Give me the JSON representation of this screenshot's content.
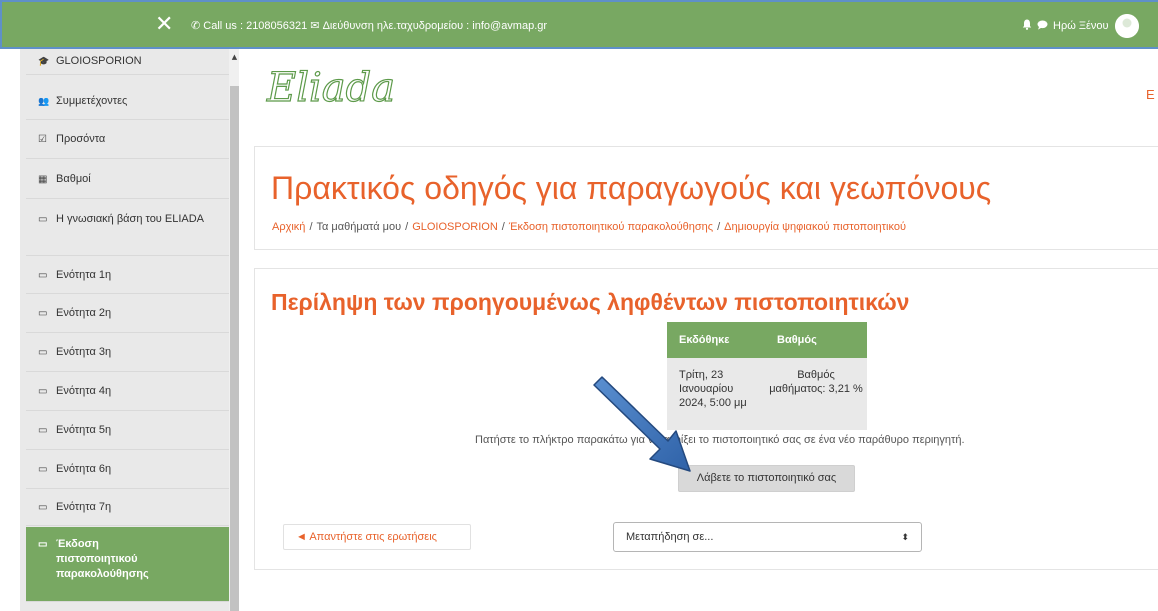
{
  "topbar": {
    "close_glyph": "✕",
    "contact_text": "Call us : 2108056321 ✉ Διεύθυνση ηλε.ταχυδρομείου : info@avmap.gr",
    "phone_icon": "phone-icon",
    "user_name": "Ηρώ Ξένου",
    "icons": [
      "bell-icon",
      "chat-icon",
      "avatar-icon"
    ]
  },
  "sidebar": {
    "items": [
      {
        "icon": "graduation-cap-icon",
        "glyph": "🎓",
        "label": "GLOIOSPORION"
      },
      {
        "icon": "users-icon",
        "glyph": "👥",
        "label": "Συμμετέχοντες"
      },
      {
        "icon": "checkbox-icon",
        "glyph": "☑",
        "label": "Προσόντα"
      },
      {
        "icon": "table-icon",
        "glyph": "▦",
        "label": "Βαθμοί"
      },
      {
        "icon": "folder-icon",
        "glyph": "▭",
        "label": "Η γνωσιακή βάση του ELIADA"
      },
      {
        "icon": "folder-icon",
        "glyph": "▭",
        "label": "Ενότητα 1η"
      },
      {
        "icon": "folder-icon",
        "glyph": "▭",
        "label": "Ενότητα 2η"
      },
      {
        "icon": "folder-icon",
        "glyph": "▭",
        "label": "Ενότητα 3η"
      },
      {
        "icon": "folder-icon",
        "glyph": "▭",
        "label": "Ενότητα 4η"
      },
      {
        "icon": "folder-icon",
        "glyph": "▭",
        "label": "Ενότητα 5η"
      },
      {
        "icon": "folder-icon",
        "glyph": "▭",
        "label": "Ενότητα 6η"
      },
      {
        "icon": "folder-icon",
        "glyph": "▭",
        "label": "Ενότητα 7η"
      },
      {
        "icon": "folder-icon",
        "glyph": "▭",
        "label": "Έκδοση πιστοποιητικού παρακολούθησης"
      }
    ]
  },
  "header": {
    "logo_text": "Eliada",
    "top_right_letter": "E"
  },
  "page": {
    "title": "Πρακτικός οδηγός για παραγωγούς και γεωπόνους",
    "breadcrumb": {
      "home": "Αρχική",
      "my_courses": "Τα μαθήματά μου",
      "course": "GLOIOSPORION",
      "section": "Έκδοση πιστοποιητικού παρακολούθησης",
      "activity": "Δημιουργία ψηφιακού πιστοποιητικού",
      "separator": "/"
    }
  },
  "certificates": {
    "heading": "Περίληψη των προηγουμένως ληφθέντων πιστοποιητικών",
    "columns": [
      "Εκδόθηκε",
      "Βαθμός"
    ],
    "rows": [
      {
        "issued": "Τρίτη, 23 Ιανουαρίου 2024, 5:00 μμ",
        "grade": "Βαθμός μαθήματος: 3,21 %"
      }
    ],
    "instruction": "Πατήστε το πλήκτρο παρακάτω για να ανοίξει το πιστοποιητικό σας σε ένα νέο παράθυρο περιηγητή.",
    "button_label": "Λάβετε το πιστοποιητικό σας"
  },
  "navigation": {
    "prev_label": "◄ Απαντήστε στις ερωτήσεις",
    "jump_placeholder": "Μεταπήδηση σε...",
    "jump_caret": "⬍"
  },
  "colors": {
    "accent_green": "#78a862",
    "accent_orange": "#e8622b",
    "annotation_arrow": "#3c74b8"
  }
}
